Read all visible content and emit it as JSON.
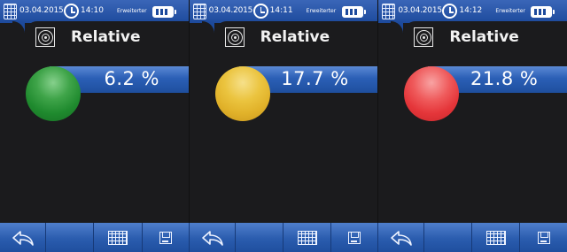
{
  "panels": [
    {
      "status": {
        "date": "03.04.2015",
        "time": "14:10",
        "mode": "Erweiterter"
      },
      "label": "Relative",
      "value": "6.2 %",
      "indicator": "green"
    },
    {
      "status": {
        "date": "03.04.2015",
        "time": "14:11",
        "mode": "Erweiterter"
      },
      "label": "Relative",
      "value": "17.7 %",
      "indicator": "yellow"
    },
    {
      "status": {
        "date": "03.04.2015",
        "time": "14:12",
        "mode": "Erweiterter"
      },
      "label": "Relative",
      "value": "21.8 %",
      "indicator": "red"
    }
  ],
  "colors": {
    "header_blue": "#1d4a9c",
    "bar_blue": "#2b5fb6",
    "background": "#1b1b1d",
    "green": "#1f8a2e",
    "yellow": "#e1b22a",
    "red": "#e5363a"
  },
  "icons": {
    "calendar": "calendar-icon",
    "clock": "clock-icon",
    "battery": "battery-icon",
    "relative": "relative-target-icon",
    "back": "back-arrow-icon",
    "table": "table-grid-icon",
    "save": "save-disk-icon"
  }
}
